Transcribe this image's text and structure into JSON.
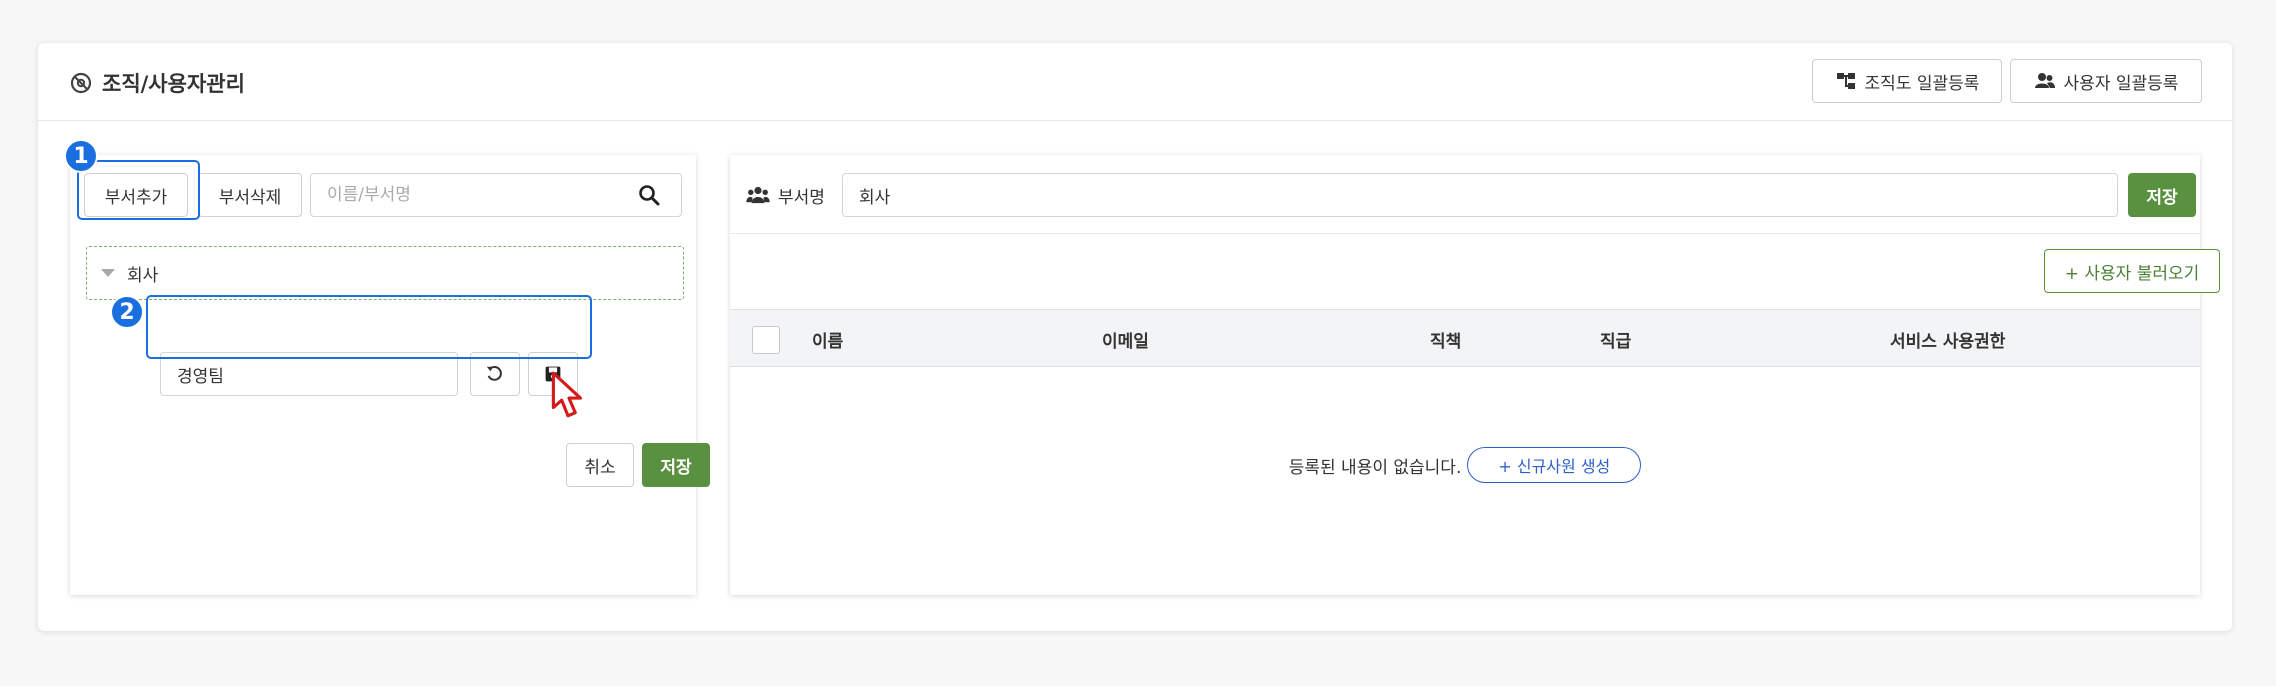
{
  "header": {
    "title": "조직/사용자관리",
    "org_bulk_button": "조직도 일괄등록",
    "user_bulk_button": "사용자 일괄등록"
  },
  "left_panel": {
    "add_dept_button": "부서추가",
    "delete_dept_button": "부서삭제",
    "search": {
      "placeholder": "이름/부서명",
      "value": ""
    },
    "tree_root_label": "회사",
    "new_dept_input": {
      "value": "경영팀"
    },
    "cancel_button": "취소",
    "save_button": "저장",
    "callouts": [
      "1",
      "2"
    ]
  },
  "right_panel": {
    "dept_name_label": "부서명",
    "dept_name_value": "회사",
    "save_button": "저장",
    "load_users_button": "+ 사용자 불러오기",
    "columns": [
      "이름",
      "이메일",
      "직책",
      "직급",
      "서비스 사용권한"
    ],
    "empty_message": "등록된 내용이 없습니다.",
    "new_employee_button": "+ 신규사원 생성"
  },
  "colors": {
    "accent_green": "#5a9141",
    "highlight_blue": "#1a6fe0",
    "link_blue": "#2e5fc9"
  }
}
